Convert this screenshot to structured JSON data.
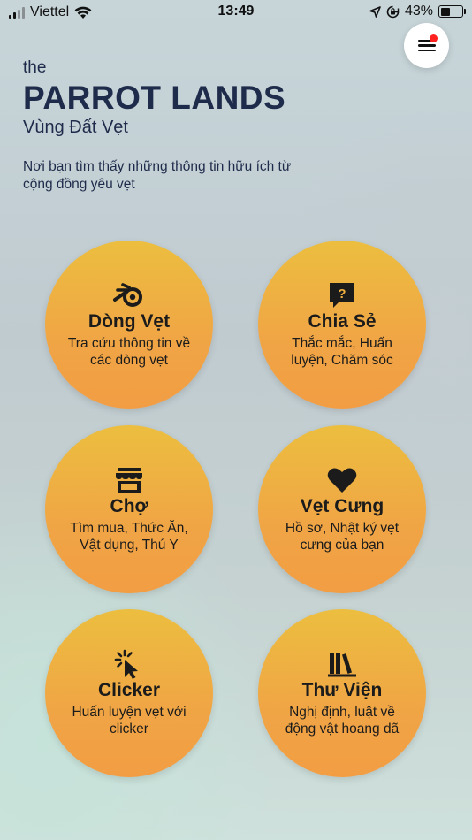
{
  "status_bar": {
    "carrier": "Viettel",
    "time": "13:49",
    "battery": "43%"
  },
  "header": {
    "the": "the",
    "brand": "PARROT LANDS",
    "subtitle": "Vùng Đất Vẹt",
    "tagline": "Nơi bạn tìm thấy những thông tin hữu ích từ cộng đồng yêu vẹt"
  },
  "menu": {
    "icon": "hamburger-menu-icon",
    "has_notification": true
  },
  "tiles": [
    {
      "icon": "blender-logo-icon",
      "title": "Dòng Vẹt",
      "desc": "Tra cứu thông tin về các dòng vẹt"
    },
    {
      "icon": "question-bubble-icon",
      "title": "Chia Sẻ",
      "desc": "Thắc mắc, Huấn luyện, Chăm sóc"
    },
    {
      "icon": "store-icon",
      "title": "Chợ",
      "desc": "Tìm mua, Thức Ăn, Vật dụng, Thú Y"
    },
    {
      "icon": "heart-icon",
      "title": "Vẹt Cưng",
      "desc": "Hồ sơ, Nhật ký vẹt cưng của bạn"
    },
    {
      "icon": "cursor-click-icon",
      "title": "Clicker",
      "desc": "Huấn luyện vẹt với clicker"
    },
    {
      "icon": "books-icon",
      "title": "Thư Viện",
      "desc": "Nghị định, luật về động vật hoang dã"
    }
  ],
  "colors": {
    "tile_top": "#ecbe3f",
    "tile_bottom": "#f29d44",
    "title_text": "#1f2b4a",
    "notification_dot": "#ff2020"
  }
}
